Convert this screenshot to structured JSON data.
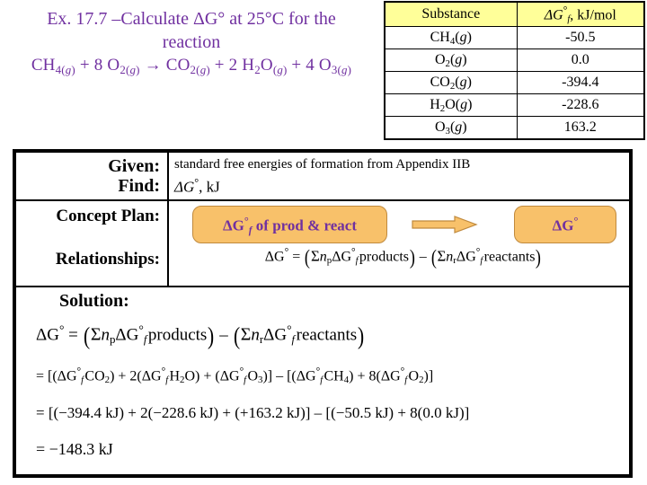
{
  "title": {
    "line1": "Ex. 17.7 –Calculate ΔG° at 25°C for the",
    "line2": "reaction",
    "line3_parts": {
      "reactants": "CH4(g) + 8 O2(g)",
      "arrow": "→",
      "products": "CO2(g) + 2 H2O(g) + 4 O3(g)"
    },
    "color": "#7030A0"
  },
  "data_table": {
    "header_bg": "#FFFF99",
    "columns": [
      "Substance",
      "ΔG°f, kJ/mol"
    ],
    "rows": [
      {
        "substance": "CH4(g)",
        "dgf": "-50.5"
      },
      {
        "substance": "O2(g)",
        "dgf": "0.0"
      },
      {
        "substance": "CO2(g)",
        "dgf": "-394.4"
      },
      {
        "substance": "H2O(g)",
        "dgf": "-228.6"
      },
      {
        "substance": "O3(g)",
        "dgf": "163.2"
      }
    ]
  },
  "worksheet": {
    "given_label": "Given:",
    "given_value": "standard free energies of formation from Appendix IIB",
    "find_label": "Find:",
    "find_value": "ΔG°, kJ",
    "concept_plan_label": "Concept Plan:",
    "concept_plan": {
      "box1": "ΔG°f of prod & react",
      "arrow": "⟹",
      "box2": "ΔG°",
      "box_color": "#F8C16A",
      "text_color": "#7030A0"
    },
    "relationships_label": "Relationships:",
    "relationships_formula": "ΔG° = (Σnp ΔG°f products) – (Σnr ΔG°f reactants)",
    "solution_label": "Solution:",
    "solution_lines": [
      "ΔG° = (Σnp ΔG°f products) – (Σnr ΔG°f reactants)",
      "= [(ΔG°f CO2) + 2(ΔG°f H2O) + (ΔG°f O3)] – [(ΔG°f CH4) + 8(ΔG°f O2)]",
      "= [(–394.4 kJ) + 2(–228.6 kJ) + (+163.2 kJ)] – [(–50.5 kJ) + 8(0.0 kJ)]",
      "= –148.3 kJ"
    ]
  }
}
